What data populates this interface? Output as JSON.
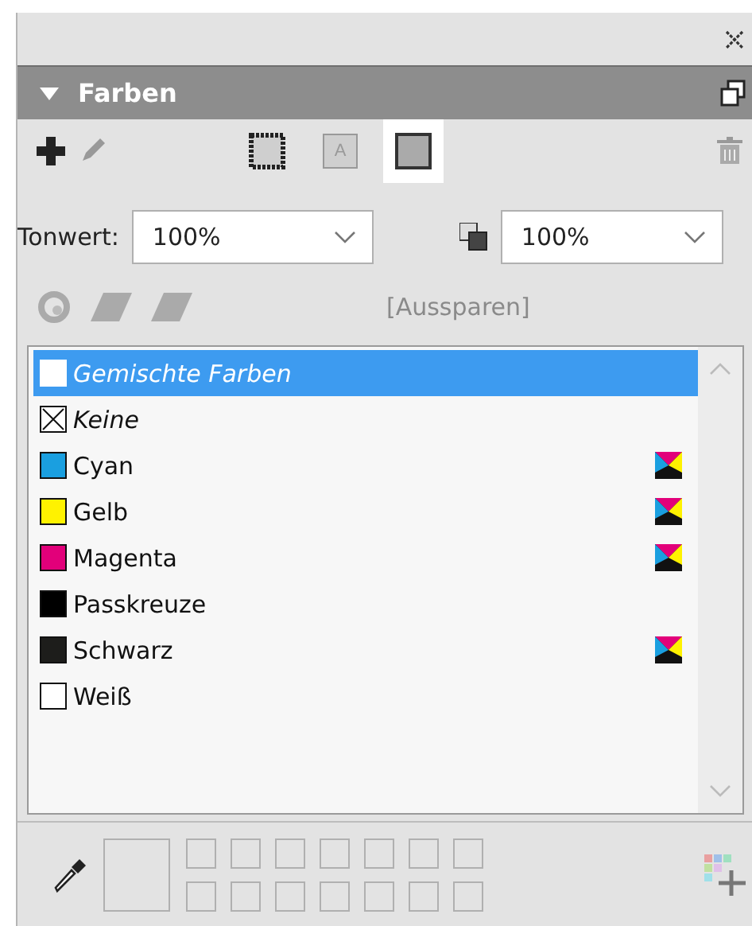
{
  "panel": {
    "title": "Farben",
    "expanded": true
  },
  "mode_buttons": [
    {
      "kind": "stroke",
      "selected": false
    },
    {
      "kind": "text",
      "label": "A",
      "selected": false
    },
    {
      "kind": "fill",
      "selected": true
    }
  ],
  "tint": {
    "label": "Tonwert:",
    "value": "100%"
  },
  "opacity": {
    "value": "100%"
  },
  "overprint": {
    "label": "[Aussparen]"
  },
  "swatches": [
    {
      "kind": "mixed",
      "name": "Gemischte Farben",
      "color": "#ffffff",
      "process": false,
      "selected": true
    },
    {
      "kind": "none",
      "name": "Keine",
      "color": "#ffffff",
      "process": false,
      "selected": false
    },
    {
      "kind": "color",
      "name": "Cyan",
      "color": "#1a9fe0",
      "process": true,
      "selected": false
    },
    {
      "kind": "color",
      "name": "Gelb",
      "color": "#fff200",
      "process": true,
      "selected": false
    },
    {
      "kind": "color",
      "name": "Magenta",
      "color": "#e2007a",
      "process": true,
      "selected": false
    },
    {
      "kind": "color",
      "name": "Passkreuze",
      "color": "#000000",
      "process": false,
      "selected": false
    },
    {
      "kind": "color",
      "name": "Schwarz",
      "color": "#1d1d1b",
      "process": true,
      "selected": false
    },
    {
      "kind": "color",
      "name": "Weiß",
      "color": "#ffffff",
      "process": false,
      "selected": false
    }
  ]
}
